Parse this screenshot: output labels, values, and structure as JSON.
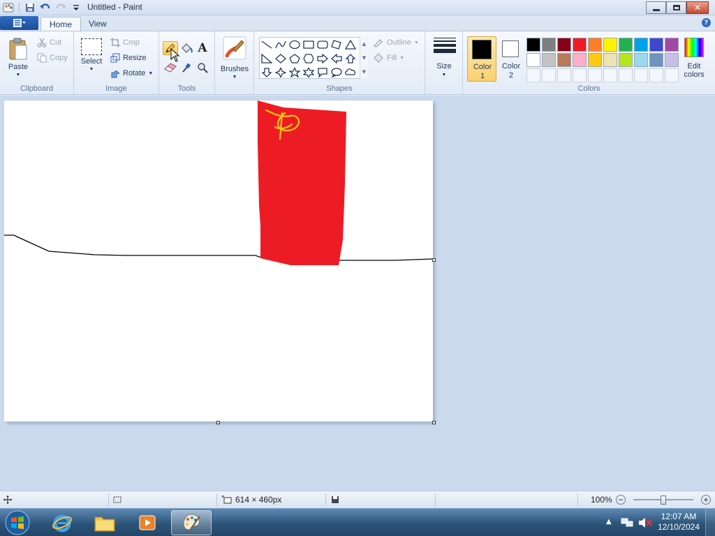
{
  "window": {
    "title": "Untitled - Paint",
    "minimize_icon": "minimize-icon",
    "maximize_icon": "restore-icon",
    "close_icon": "close-icon"
  },
  "tabs": [
    {
      "label": "Home",
      "active": true
    },
    {
      "label": "View",
      "active": false
    }
  ],
  "ribbon": {
    "clipboard": {
      "label": "Clipboard",
      "paste": "Paste",
      "cut": "Cut",
      "copy": "Copy"
    },
    "image": {
      "label": "Image",
      "select": "Select",
      "crop": "Crop",
      "resize": "Resize",
      "rotate": "Rotate"
    },
    "tools": {
      "label": "Tools",
      "selected": "pencil"
    },
    "brushes": {
      "label": "Brushes"
    },
    "shapes": {
      "label": "Shapes",
      "outline": "Outline",
      "fill": "Fill"
    },
    "size": {
      "label": "Size"
    },
    "colors": {
      "label": "Colors",
      "color1_label": "Color 1",
      "color1_line1": "Color",
      "color1_line2": "1",
      "color1": "#000000",
      "color2_line1": "Color",
      "color2_line2": "2",
      "color2": "#ffffff",
      "edit_line1": "Edit",
      "edit_line2": "colors",
      "palette": [
        "#000000",
        "#7f7f7f",
        "#880015",
        "#ed1c24",
        "#ff7f27",
        "#fff200",
        "#22b14c",
        "#00a2e8",
        "#3f48cc",
        "#a349a4",
        "#ffffff",
        "#c3c3c3",
        "#b97a57",
        "#ffaec9",
        "#ffc90e",
        "#efe4b0",
        "#b5e61d",
        "#99d9ea",
        "#7092be",
        "#c8bfe7"
      ]
    }
  },
  "canvas": {
    "line_color": "#000000",
    "rect_color": "#ed1c24",
    "scribble_color": "#ffc90e"
  },
  "status": {
    "dimensions": "614 × 460px",
    "zoom": "100%",
    "zoom_level": 100
  },
  "taskbar": {
    "time": "12:07 AM",
    "date": "12/10/2024"
  }
}
